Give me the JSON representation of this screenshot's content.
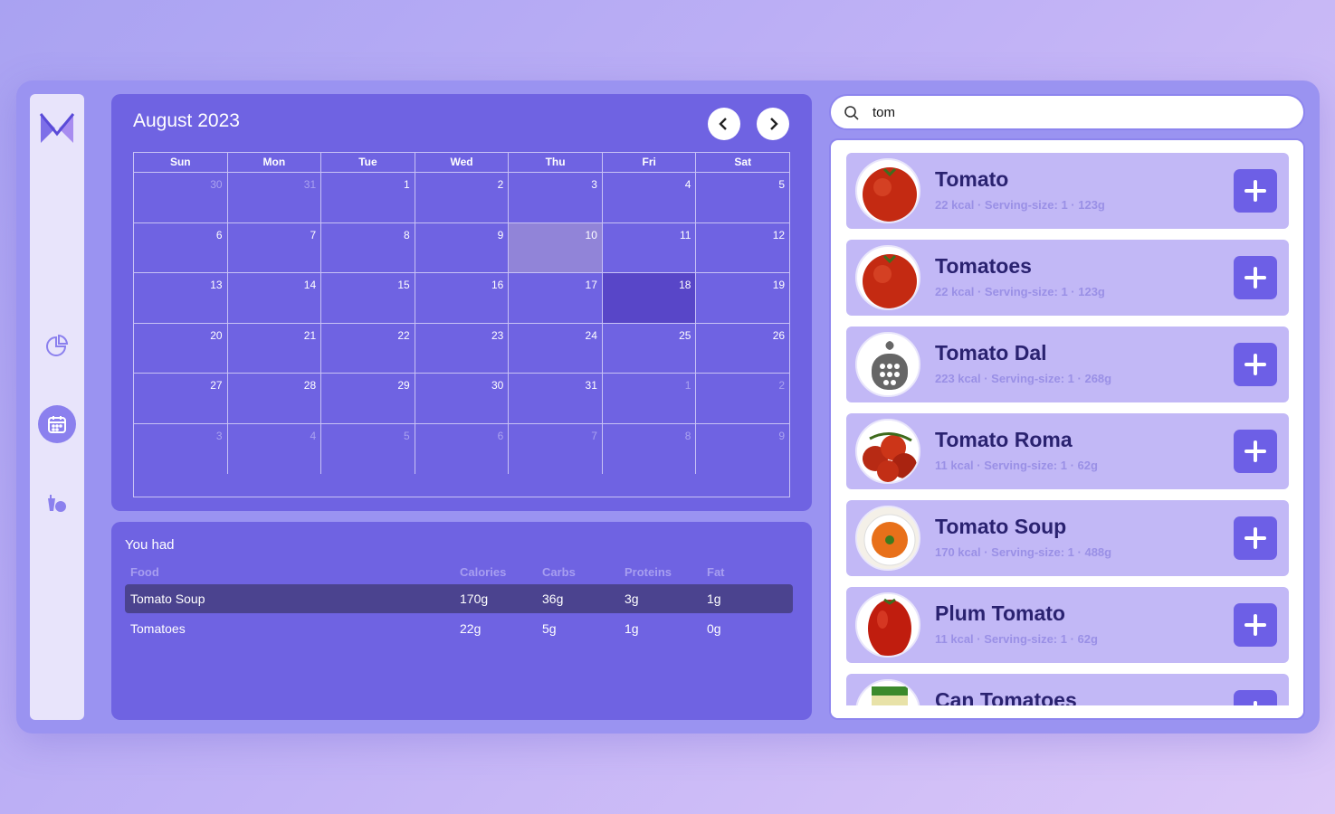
{
  "calendar": {
    "title": "August 2023",
    "weekdays": [
      "Sun",
      "Mon",
      "Tue",
      "Wed",
      "Thu",
      "Fri",
      "Sat"
    ],
    "weeks": [
      [
        {
          "d": "30",
          "m": true
        },
        {
          "d": "31",
          "m": true
        },
        {
          "d": "1"
        },
        {
          "d": "2"
        },
        {
          "d": "3"
        },
        {
          "d": "4"
        },
        {
          "d": "5"
        }
      ],
      [
        {
          "d": "6"
        },
        {
          "d": "7"
        },
        {
          "d": "8"
        },
        {
          "d": "9"
        },
        {
          "d": "10",
          "today": true
        },
        {
          "d": "11"
        },
        {
          "d": "12"
        }
      ],
      [
        {
          "d": "13"
        },
        {
          "d": "14"
        },
        {
          "d": "15"
        },
        {
          "d": "16"
        },
        {
          "d": "17"
        },
        {
          "d": "18",
          "sel": true
        },
        {
          "d": "19"
        }
      ],
      [
        {
          "d": "20"
        },
        {
          "d": "21"
        },
        {
          "d": "22"
        },
        {
          "d": "23"
        },
        {
          "d": "24"
        },
        {
          "d": "25"
        },
        {
          "d": "26"
        }
      ],
      [
        {
          "d": "27"
        },
        {
          "d": "28"
        },
        {
          "d": "29"
        },
        {
          "d": "30"
        },
        {
          "d": "31"
        },
        {
          "d": "1",
          "m": true
        },
        {
          "d": "2",
          "m": true
        }
      ],
      [
        {
          "d": "3",
          "m": true
        },
        {
          "d": "4",
          "m": true
        },
        {
          "d": "5",
          "m": true
        },
        {
          "d": "6",
          "m": true
        },
        {
          "d": "7",
          "m": true
        },
        {
          "d": "8",
          "m": true
        },
        {
          "d": "9",
          "m": true
        }
      ]
    ]
  },
  "had": {
    "title": "You had",
    "headers": [
      "Food",
      "Calories",
      "Carbs",
      "Proteins",
      "Fat"
    ],
    "rows": [
      [
        "Tomato Soup",
        "170g",
        "36g",
        "3g",
        "1g"
      ],
      [
        "Tomatoes",
        "22g",
        "5g",
        "1g",
        "0g"
      ]
    ]
  },
  "search": {
    "value": "tom"
  },
  "results": [
    {
      "name": "Tomato",
      "meta": "22 kcal · Serving-size: 1 · 123g",
      "thumb": "tomato"
    },
    {
      "name": "Tomatoes",
      "meta": "22 kcal · Serving-size: 1 · 123g",
      "thumb": "tomato"
    },
    {
      "name": "Tomato Dal",
      "meta": "223 kcal · Serving-size: 1 · 268g",
      "thumb": "placeholder"
    },
    {
      "name": "Tomato Roma",
      "meta": "11 kcal · Serving-size: 1 · 62g",
      "thumb": "roma"
    },
    {
      "name": "Tomato Soup",
      "meta": "170 kcal · Serving-size: 1 · 488g",
      "thumb": "soup"
    },
    {
      "name": "Plum Tomato",
      "meta": "11 kcal · Serving-size: 1 · 62g",
      "thumb": "plum"
    },
    {
      "name": "Can Tomatoes",
      "meta": "",
      "thumb": "can"
    }
  ],
  "icons": {
    "sidebar": [
      "logo-icon",
      "chart-pie-icon",
      "calendar-icon",
      "food-icon"
    ],
    "search": "search-icon",
    "prev": "chevron-left-icon",
    "next": "chevron-right-icon",
    "add": "plus-icon"
  },
  "colors": {
    "accent": "#6f63e2",
    "selected_day": "#5846c8",
    "today": "#9184d8",
    "result_card": "#c2b8f6",
    "add_button": "#6d5fe6"
  }
}
